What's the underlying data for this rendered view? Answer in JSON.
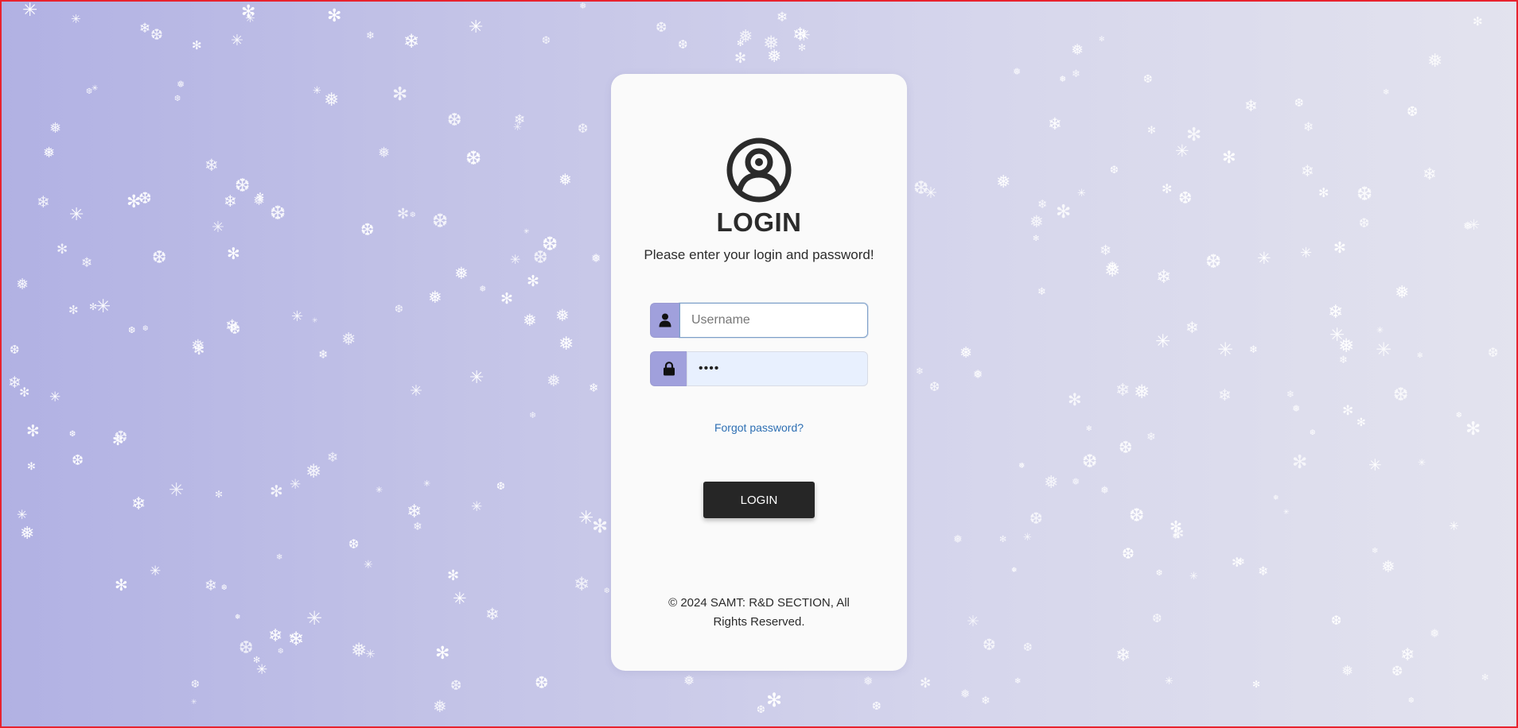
{
  "login": {
    "title": "LOGIN",
    "subtitle": "Please enter your login and password!",
    "username_placeholder": "Username",
    "username_value": "",
    "password_value": "••••",
    "forgot_label": "Forgot password?",
    "submit_label": "LOGIN",
    "footer_line1": "© 2024 SAMT: R&D SECTION, All",
    "footer_line2": "Rights Reserved."
  },
  "icons": {
    "avatar": "user-circle-icon",
    "username": "user-icon",
    "password": "lock-icon",
    "background": "snowflake-icon"
  },
  "colors": {
    "background_start": "#b1b1e3",
    "background_end": "#e3e3ee",
    "card": "#fafafa",
    "input_addon": "#a0a0dc",
    "button": "#262626",
    "link": "#2d6fb3",
    "frame_border": "#e8222e"
  }
}
